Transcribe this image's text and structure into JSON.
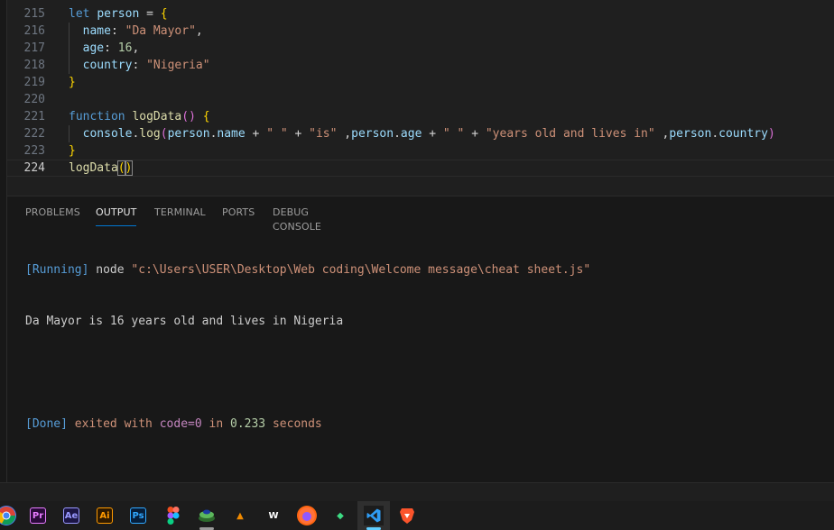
{
  "editor": {
    "lines": [
      {
        "num": "215",
        "tokens": [
          {
            "t": "let",
            "c": "kw"
          },
          {
            "t": " ",
            "c": "punc"
          },
          {
            "t": "person",
            "c": "var"
          },
          {
            "t": " = ",
            "c": "punc"
          },
          {
            "t": "{",
            "c": "br1"
          }
        ]
      },
      {
        "num": "216",
        "tokens": [
          {
            "t": "  name",
            "c": "var"
          },
          {
            "t": ": ",
            "c": "punc"
          },
          {
            "t": "\"Da Mayor\"",
            "c": "str"
          },
          {
            "t": ",",
            "c": "punc"
          }
        ]
      },
      {
        "num": "217",
        "tokens": [
          {
            "t": "  age",
            "c": "var"
          },
          {
            "t": ": ",
            "c": "punc"
          },
          {
            "t": "16",
            "c": "num"
          },
          {
            "t": ",",
            "c": "punc"
          }
        ]
      },
      {
        "num": "218",
        "tokens": [
          {
            "t": "  country",
            "c": "var"
          },
          {
            "t": ": ",
            "c": "punc"
          },
          {
            "t": "\"Nigeria\"",
            "c": "str"
          }
        ]
      },
      {
        "num": "219",
        "tokens": [
          {
            "t": "}",
            "c": "br1"
          }
        ]
      },
      {
        "num": "220",
        "tokens": []
      },
      {
        "num": "221",
        "tokens": [
          {
            "t": "function",
            "c": "kw"
          },
          {
            "t": " ",
            "c": "punc"
          },
          {
            "t": "logData",
            "c": "fn"
          },
          {
            "t": "()",
            "c": "br2"
          },
          {
            "t": " ",
            "c": "punc"
          },
          {
            "t": "{",
            "c": "br1"
          }
        ]
      },
      {
        "num": "222",
        "tokens": [
          {
            "t": "  console",
            "c": "var"
          },
          {
            "t": ".",
            "c": "punc"
          },
          {
            "t": "log",
            "c": "fn"
          },
          {
            "t": "(",
            "c": "br2"
          },
          {
            "t": "person",
            "c": "var"
          },
          {
            "t": ".",
            "c": "punc"
          },
          {
            "t": "name",
            "c": "var"
          },
          {
            "t": " + ",
            "c": "punc"
          },
          {
            "t": "\" \"",
            "c": "str"
          },
          {
            "t": " + ",
            "c": "punc"
          },
          {
            "t": "\"is\"",
            "c": "str"
          },
          {
            "t": " ,",
            "c": "punc"
          },
          {
            "t": "person",
            "c": "var"
          },
          {
            "t": ".",
            "c": "punc"
          },
          {
            "t": "age",
            "c": "var"
          },
          {
            "t": " + ",
            "c": "punc"
          },
          {
            "t": "\" \"",
            "c": "str"
          },
          {
            "t": " + ",
            "c": "punc"
          },
          {
            "t": "\"years old and lives in\"",
            "c": "str"
          },
          {
            "t": " ,",
            "c": "punc"
          },
          {
            "t": "person",
            "c": "var"
          },
          {
            "t": ".",
            "c": "punc"
          },
          {
            "t": "country",
            "c": "var"
          },
          {
            "t": ")",
            "c": "br2"
          }
        ]
      },
      {
        "num": "223",
        "tokens": [
          {
            "t": "}",
            "c": "br1"
          }
        ]
      },
      {
        "num": "224",
        "current": true,
        "tokens": [
          {
            "t": "logData",
            "c": "fn"
          },
          {
            "t": "(",
            "c": "br1 bracket-box"
          },
          {
            "t": ")",
            "c": "br1 bracket-box"
          }
        ]
      }
    ]
  },
  "panel": {
    "tabs": [
      {
        "label": "PROBLEMS",
        "active": false,
        "name": "tab-problems"
      },
      {
        "label": "OUTPUT",
        "active": true,
        "name": "tab-output"
      },
      {
        "label": "TERMINAL",
        "active": false,
        "name": "tab-terminal"
      },
      {
        "label": "PORTS",
        "active": false,
        "name": "tab-ports"
      },
      {
        "label": "DEBUG CONSOLE",
        "active": false,
        "name": "tab-debug-console"
      }
    ],
    "output": {
      "running_tag": "[Running]",
      "running_cmd": " node ",
      "running_path": "\"c:\\Users\\USER\\Desktop\\Web coding\\Welcome message\\cheat sheet.js\"",
      "result_line": "Da Mayor is 16 years old and lives in Nigeria",
      "done_tag": "[Done]",
      "done_exited": " exited with ",
      "done_code": "code=0",
      "done_in": " in ",
      "done_time": "0.233",
      "done_seconds": " seconds"
    }
  },
  "taskbar": {
    "icons": [
      {
        "name": "chrome-icon",
        "glyph": "",
        "bg": "#4285f4",
        "fg": "#ffffff",
        "round": true
      },
      {
        "name": "premiere-pro-icon",
        "glyph": "Pr",
        "bg": "#2a0a3a",
        "fg": "#e77cff"
      },
      {
        "name": "after-effects-icon",
        "glyph": "Ae",
        "bg": "#1c1545",
        "fg": "#9999ff"
      },
      {
        "name": "illustrator-icon",
        "glyph": "Ai",
        "bg": "#2e1a00",
        "fg": "#ff9a00"
      },
      {
        "name": "photoshop-icon",
        "glyph": "Ps",
        "bg": "#061e3a",
        "fg": "#31a8ff"
      },
      {
        "name": "figma-icon",
        "glyph": "",
        "bg": "#1c1c1c",
        "fg": "#f24e1e"
      },
      {
        "name": "stack-icon",
        "glyph": "",
        "bg": "#1c1c1c",
        "fg": "#5cb85c"
      },
      {
        "name": "vlc-icon",
        "glyph": "▲",
        "bg": "#1c1c1c",
        "fg": "#f08a00"
      },
      {
        "name": "word-icon",
        "glyph": "W",
        "bg": "#1c1c1c",
        "fg": "#ffffff"
      },
      {
        "name": "firefox-icon",
        "glyph": "",
        "bg": "#ff6611",
        "fg": "#ffffff",
        "round": true
      },
      {
        "name": "diamond-app-icon",
        "glyph": "◆",
        "bg": "#1c1c1c",
        "fg": "#3ddc84"
      },
      {
        "name": "vscode-icon",
        "glyph": "",
        "bg": "#1c1c1c",
        "fg": "#007acc",
        "active": true
      },
      {
        "name": "brave-icon",
        "glyph": "",
        "bg": "#1c1c1c",
        "fg": "#fb542b"
      }
    ]
  }
}
